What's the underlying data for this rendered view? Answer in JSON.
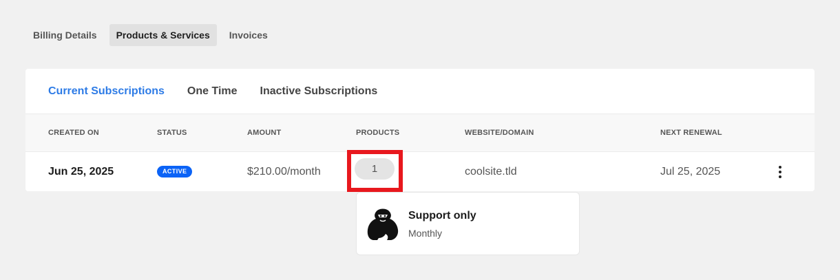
{
  "top_tabs": [
    {
      "label": "Billing Details"
    },
    {
      "label": "Products & Services"
    },
    {
      "label": "Invoices"
    }
  ],
  "sub_tabs": [
    {
      "label": "Current Subscriptions"
    },
    {
      "label": "One Time"
    },
    {
      "label": "Inactive Subscriptions"
    }
  ],
  "table": {
    "headers": [
      "CREATED ON",
      "STATUS",
      "AMOUNT",
      "PRODUCTS",
      "WEBSITE/DOMAIN",
      "NEXT RENEWAL"
    ],
    "rows": [
      {
        "created_on": "Jun 25, 2025",
        "status": "ACTIVE",
        "amount": "$210.00/month",
        "products": "1",
        "website": "coolsite.tld",
        "next_renewal": "Jul 25, 2025"
      }
    ]
  },
  "popover": {
    "product_name": "Support only",
    "cycle": "Monthly",
    "icon": "gorilla-logo-icon"
  },
  "colors": {
    "accent": "#2d7be6",
    "status_active": "#0b63f6",
    "highlight": "#e8181e"
  }
}
